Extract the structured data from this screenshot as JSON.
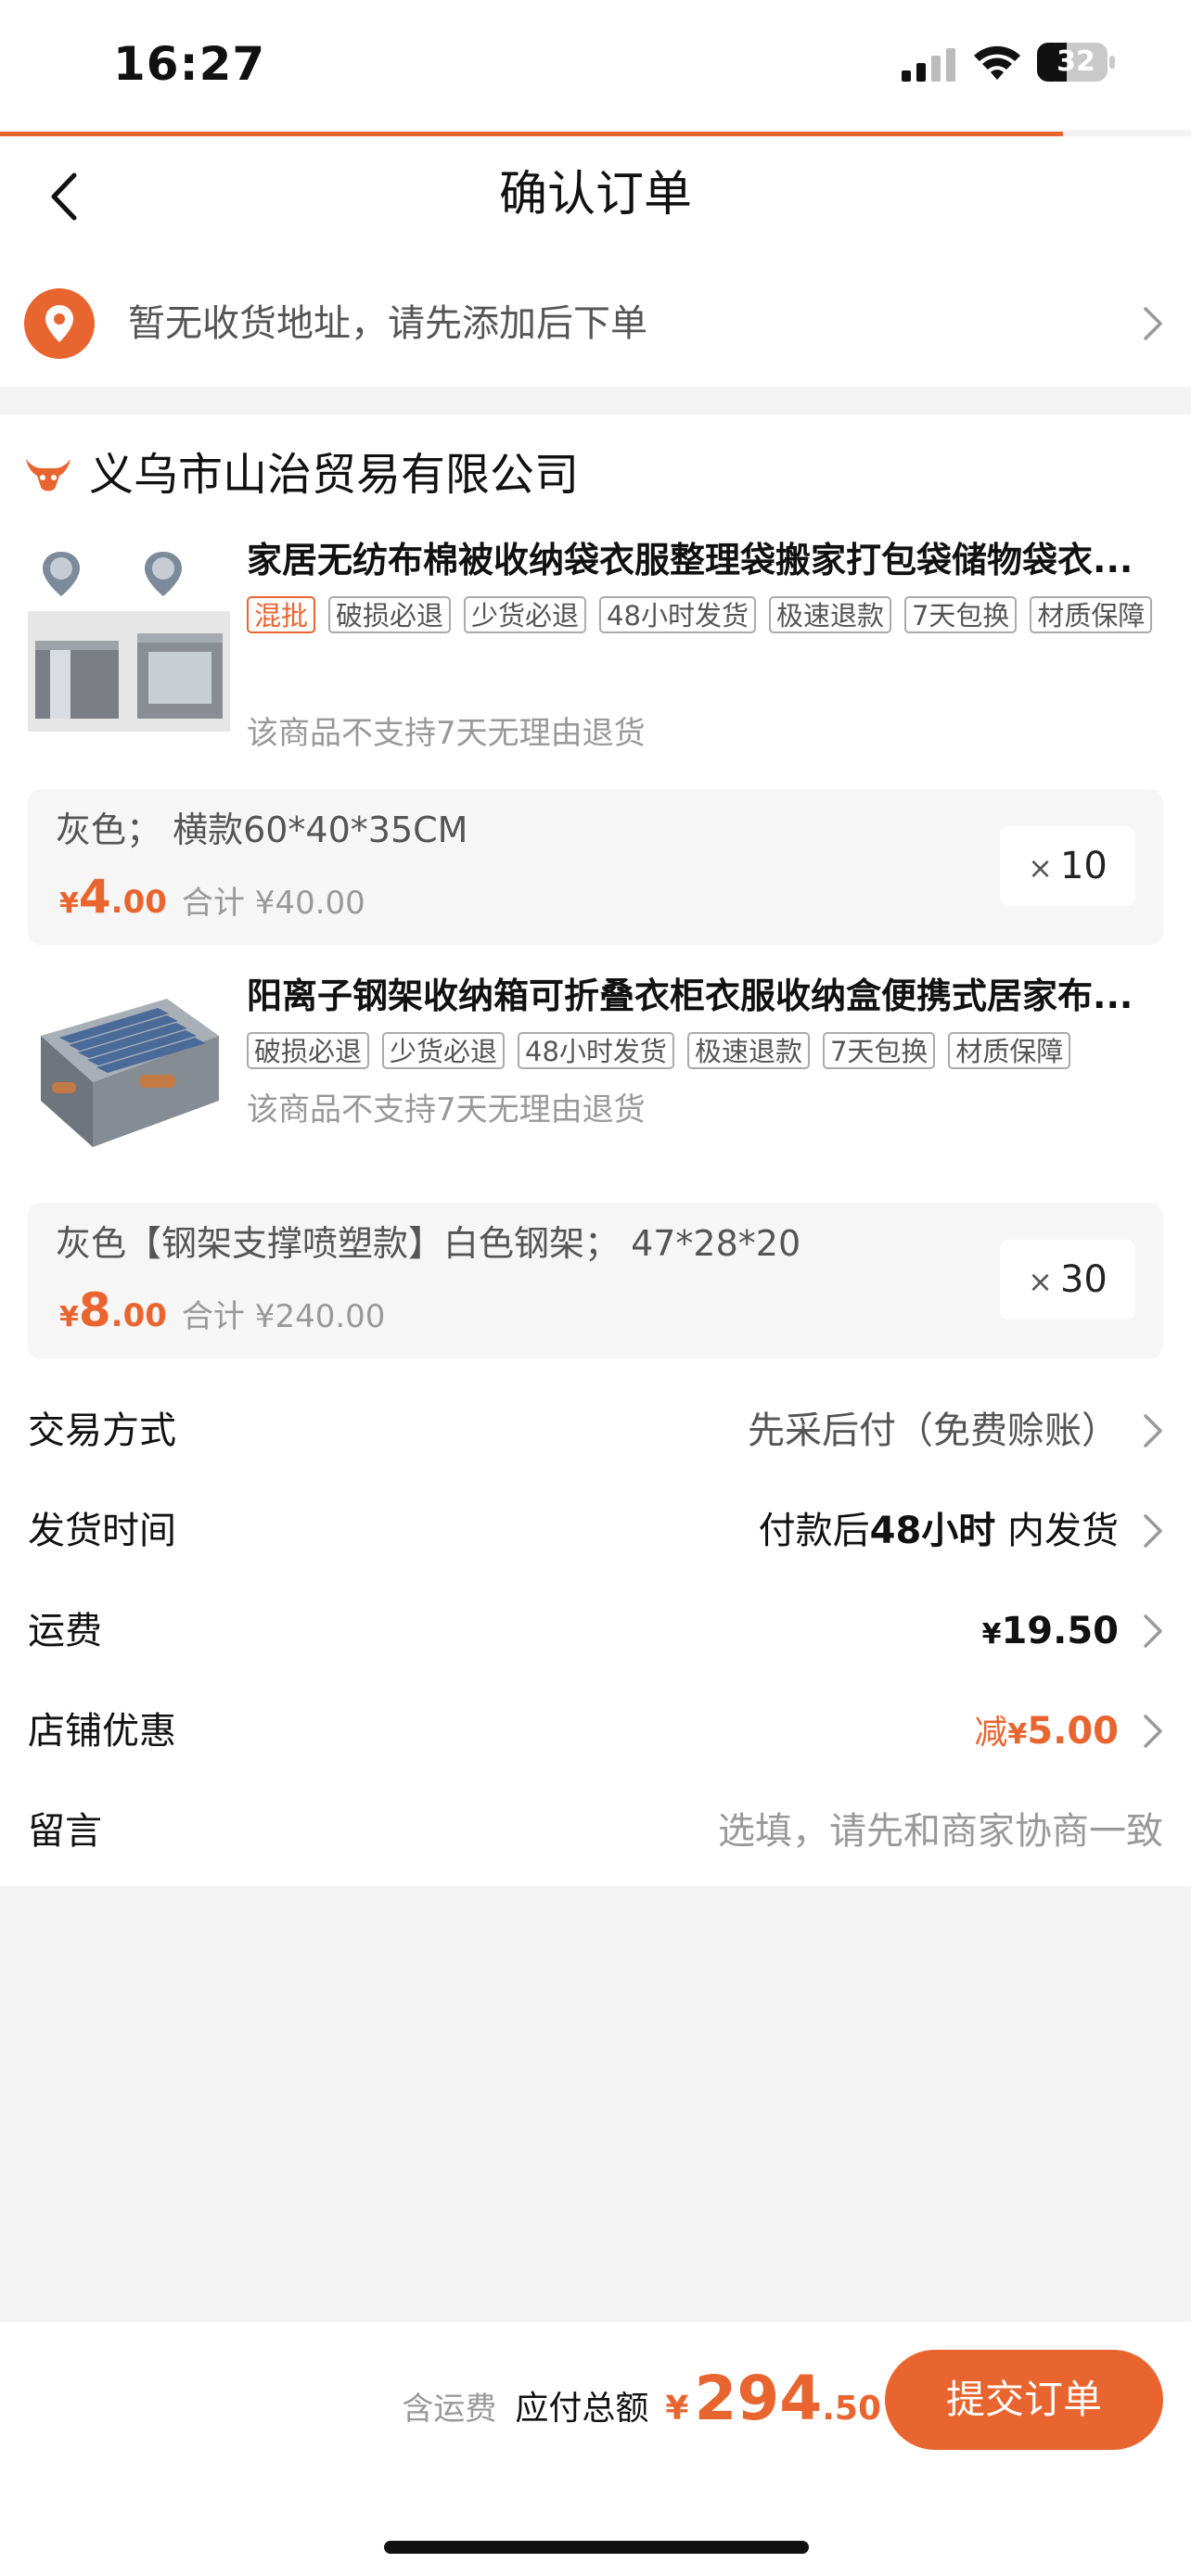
{
  "status_bar": {
    "time": "16:27",
    "battery": "32"
  },
  "nav": {
    "title": "确认订单"
  },
  "address": {
    "text": "暂无收货地址，请先添加后下单"
  },
  "shop": {
    "name": "义乌市山治贸易有限公司"
  },
  "products": [
    {
      "title": "家居无纺布棉被收纳袋衣服整理袋搬家打包袋储物袋衣...",
      "tags": [
        "混批",
        "破损必退",
        "少货必退",
        "48小时发货",
        "极速退款",
        "7天包换",
        "材质保障"
      ],
      "note": "该商品不支持7天无理由退货",
      "spec": "灰色；  横款60*40*35CM",
      "price_symbol": "¥",
      "price_int": "4",
      "price_dec": ".00",
      "subtotal": "合计 ¥40.00",
      "qty_symbol": "×",
      "qty": "10"
    },
    {
      "title": "阳离子钢架收纳箱可折叠衣柜衣服收纳盒便携式居家布...",
      "tags": [
        "破损必退",
        "少货必退",
        "48小时发货",
        "极速退款",
        "7天包换",
        "材质保障"
      ],
      "note": "该商品不支持7天无理由退货",
      "spec": "灰色【钢架支撑喷塑款】白色钢架；  47*28*20",
      "price_symbol": "¥",
      "price_int": "8",
      "price_dec": ".00",
      "subtotal": "合计 ¥240.00",
      "qty_symbol": "×",
      "qty": "30"
    }
  ],
  "info_rows": {
    "payment": {
      "label": "交易方式",
      "value": "先采后付（免费赊账）"
    },
    "delivery": {
      "label": "发货时间",
      "prefix": "付款后",
      "bold": "48小时",
      "suffix": " 内发货"
    },
    "freight": {
      "label": "运费",
      "symbol": "¥",
      "value": "19.50"
    },
    "discount": {
      "label": "店铺优惠",
      "prefix": "减",
      "symbol": "¥",
      "value": "5.00"
    },
    "message": {
      "label": "留言",
      "placeholder": "选填，请先和商家协商一致"
    }
  },
  "footer": {
    "incl_shipping": "含运费",
    "total_label": "应付总额",
    "symbol": "¥",
    "total_int": "294",
    "total_dec": ".50",
    "submit": "提交订单"
  },
  "colors": {
    "accent": "#e9652f",
    "background": "#f3f3f3"
  },
  "icons": [
    "back-icon",
    "location-pin-icon",
    "chevron-right-icon",
    "shop-bull-icon",
    "signal-icon",
    "wifi-icon",
    "battery-icon"
  ]
}
